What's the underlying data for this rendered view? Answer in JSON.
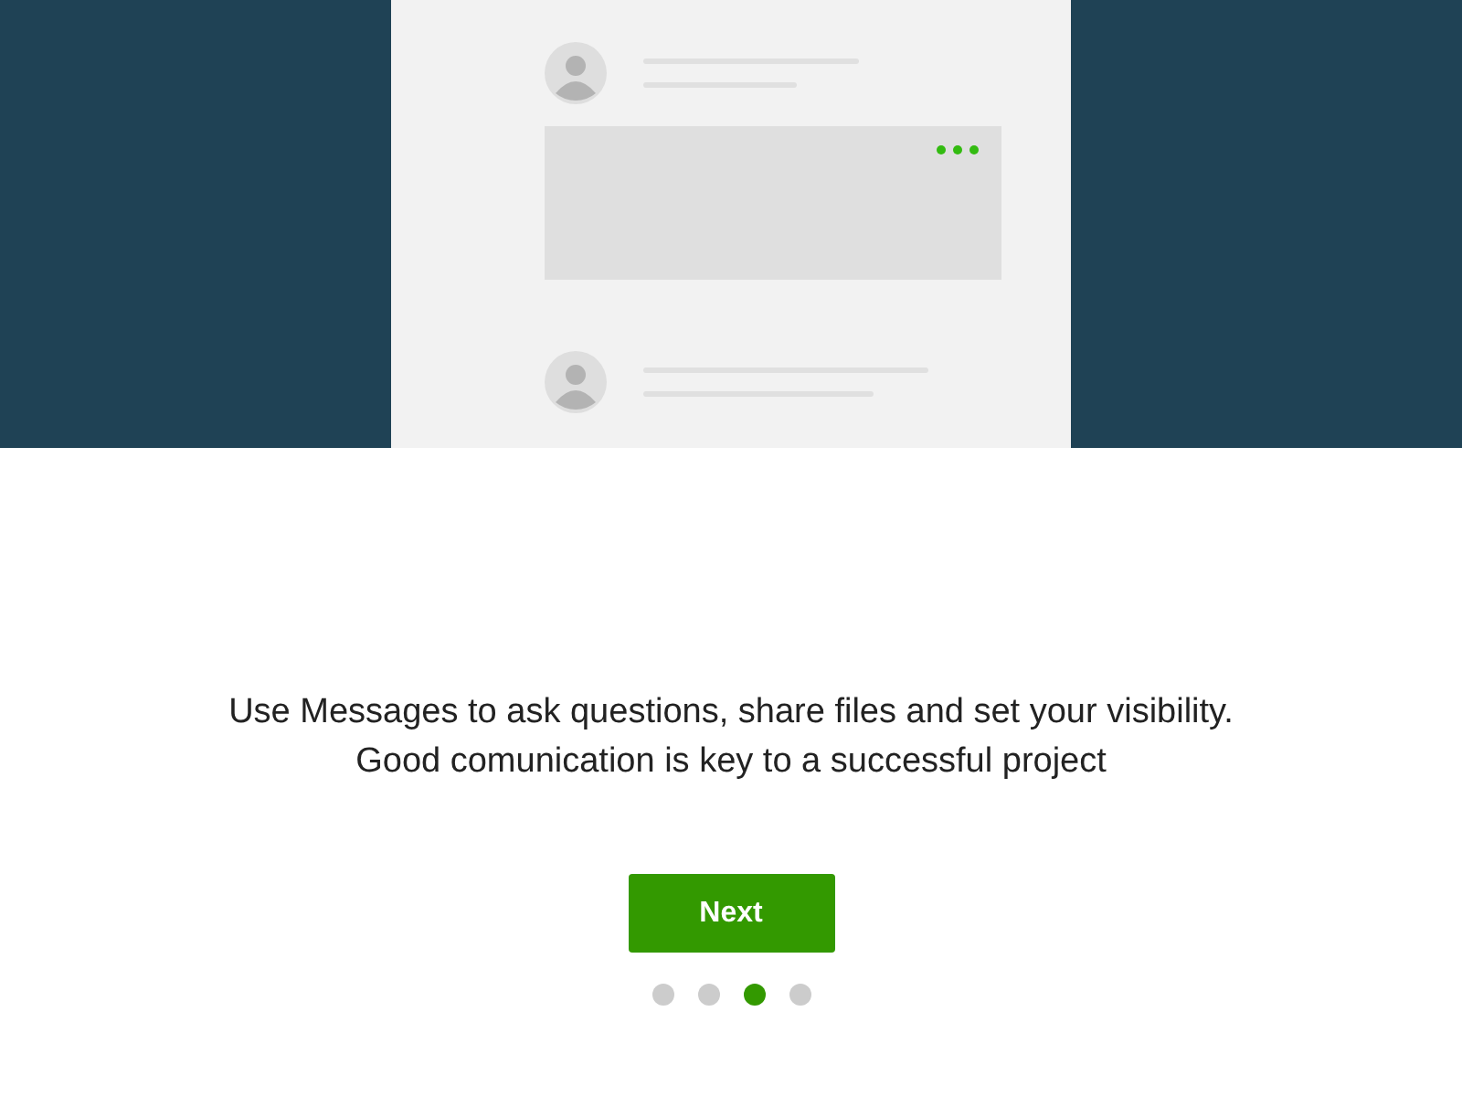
{
  "illustration": {
    "posts": [
      {
        "kind": "with_attachment"
      },
      {
        "kind": "plain"
      }
    ]
  },
  "message": "Use Messages to ask questions, share files and set your visibility.\nGood comunication is key to a successful project",
  "button": {
    "label": "Next"
  },
  "pager": [
    {
      "selected": false
    },
    {
      "selected": false
    },
    {
      "selected": true
    },
    {
      "selected": false
    }
  ]
}
